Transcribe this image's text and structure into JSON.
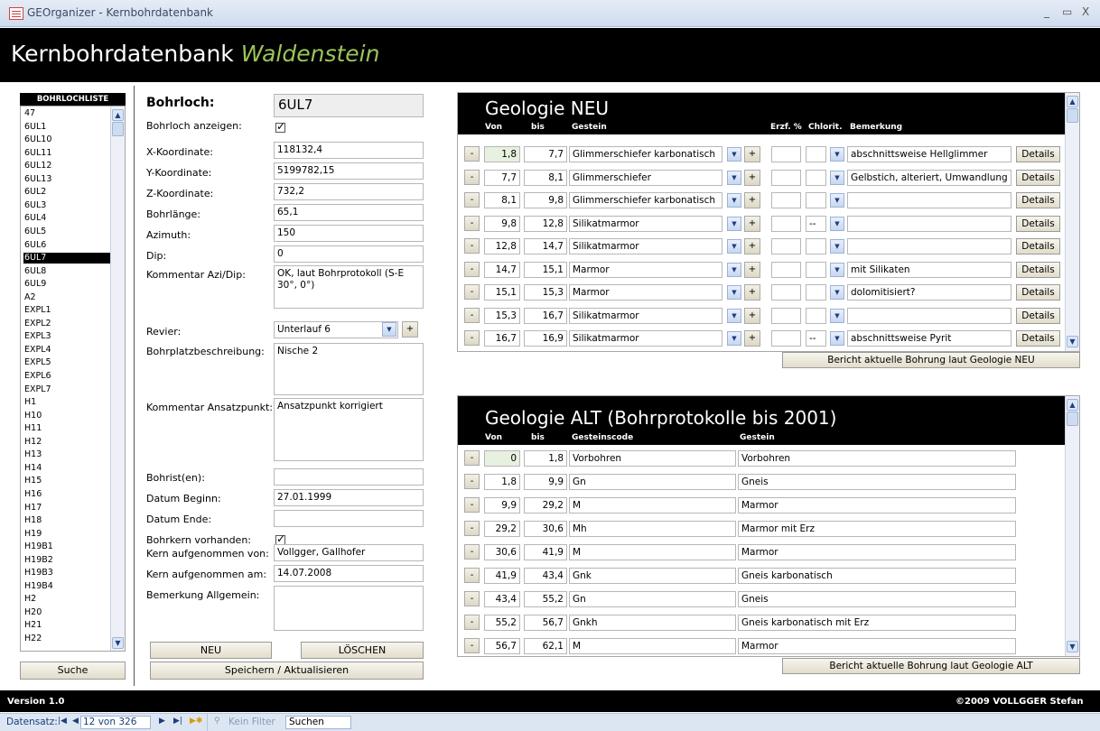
{
  "window": {
    "title": "GEOrganizer - Kernbohrdatenbank"
  },
  "header": {
    "title_main": "Kernbohrdatenbank",
    "title_accent": "Waldenstein"
  },
  "sidebar": {
    "header": "BOHRLOCHLISTE",
    "items": [
      "47",
      "6UL1",
      "6UL10",
      "6UL11",
      "6UL12",
      "6UL13",
      "6UL2",
      "6UL3",
      "6UL4",
      "6UL5",
      "6UL6",
      "6UL7",
      "6UL8",
      "6UL9",
      "A2",
      "EXPL1",
      "EXPL2",
      "EXPL3",
      "EXPL4",
      "EXPL5",
      "EXPL6",
      "EXPL7",
      "H1",
      "H10",
      "H11",
      "H12",
      "H13",
      "H14",
      "H15",
      "H16",
      "H17",
      "H18",
      "H19",
      "H19B1",
      "H19B2",
      "H19B3",
      "H19B4",
      "H2",
      "H20",
      "H21",
      "H22"
    ],
    "selected": "6UL7",
    "search_button": "Suche"
  },
  "form": {
    "bohrloch_label": "Bohrloch:",
    "bohrloch_value": "6UL7",
    "anzeigen_label": "Bohrloch anzeigen:",
    "x_label": "X-Koordinate:",
    "x_value": "118132,4",
    "y_label": "Y-Koordinate:",
    "y_value": "5199782,15",
    "z_label": "Z-Koordinate:",
    "z_value": "732,2",
    "laenge_label": "Bohrlänge:",
    "laenge_value": "65,1",
    "azimuth_label": "Azimuth:",
    "azimuth_value": "150",
    "dip_label": "Dip:",
    "dip_value": "0",
    "kommentar_azi_label": "Kommentar Azi/Dip:",
    "kommentar_azi_value": "OK, laut Bohrprotokoll (S-E 30°, 0°)",
    "revier_label": "Revier:",
    "revier_value": "Unterlauf 6",
    "platz_label": "Bohrplatzbeschreibung:",
    "platz_value": "Nische 2",
    "ansatz_label": "Kommentar Ansatzpunkt:",
    "ansatz_value": "Ansatzpunkt korrigiert",
    "bohrist_label": "Bohrist(en):",
    "bohrist_value": "",
    "beginn_label": "Datum Beginn:",
    "beginn_value": "27.01.1999",
    "ende_label": "Datum Ende:",
    "ende_value": "",
    "kern_label": "Bohrkern vorhanden:",
    "aufg_von_label": "Kern aufgenommen von:",
    "aufg_von_value": "Vollgger, Gallhofer",
    "aufg_am_label": "Kern aufgenommen am:",
    "aufg_am_value": "14.07.2008",
    "bemerkung_label": "Bemerkung Allgemein:",
    "bemerkung_value": "",
    "neu_button": "NEU",
    "loeschen_button": "LÖSCHEN",
    "speichern_button": "Speichern / Aktualisieren"
  },
  "geologie_neu": {
    "title": "Geologie NEU",
    "headers": {
      "von": "Von",
      "bis": "bis",
      "gestein": "Gestein",
      "erzf": "Erzf. %",
      "chlorit": "Chlorit.",
      "bemerkung": "Bemerkung"
    },
    "rows": [
      {
        "von": "1,8",
        "bis": "7,7",
        "gestein": "Glimmerschiefer karbonatisch",
        "chlorit": "",
        "bemerkung": "abschnittsweise Hellglimmer"
      },
      {
        "von": "7,7",
        "bis": "8,1",
        "gestein": "Glimmerschiefer",
        "chlorit": "",
        "bemerkung": "Gelbstich, alteriert, Umwandlung"
      },
      {
        "von": "8,1",
        "bis": "9,8",
        "gestein": "Glimmerschiefer karbonatisch",
        "chlorit": "",
        "bemerkung": ""
      },
      {
        "von": "9,8",
        "bis": "12,8",
        "gestein": "Silikatmarmor",
        "chlorit": "--",
        "bemerkung": ""
      },
      {
        "von": "12,8",
        "bis": "14,7",
        "gestein": "Silikatmarmor",
        "chlorit": "",
        "bemerkung": ""
      },
      {
        "von": "14,7",
        "bis": "15,1",
        "gestein": "Marmor",
        "chlorit": "",
        "bemerkung": "mit Silikaten"
      },
      {
        "von": "15,1",
        "bis": "15,3",
        "gestein": "Marmor",
        "chlorit": "",
        "bemerkung": "dolomitisiert?"
      },
      {
        "von": "15,3",
        "bis": "16,7",
        "gestein": "Silikatmarmor",
        "chlorit": "",
        "bemerkung": ""
      },
      {
        "von": "16,7",
        "bis": "16,9",
        "gestein": "Silikatmarmor",
        "chlorit": "--",
        "bemerkung": "abschnittsweise Pyrit"
      }
    ],
    "details_label": "Details",
    "report_button": "Bericht aktuelle Bohrung laut Geologie NEU"
  },
  "geologie_alt": {
    "title": "Geologie ALT (Bohrprotokolle bis 2001)",
    "headers": {
      "von": "Von",
      "bis": "bis",
      "code": "Gesteinscode",
      "gestein": "Gestein"
    },
    "rows": [
      {
        "von": "0",
        "bis": "1,8",
        "code": "Vorbohren",
        "gestein": "Vorbohren"
      },
      {
        "von": "1,8",
        "bis": "9,9",
        "code": "Gn",
        "gestein": "Gneis"
      },
      {
        "von": "9,9",
        "bis": "29,2",
        "code": "M",
        "gestein": "Marmor"
      },
      {
        "von": "29,2",
        "bis": "30,6",
        "code": "Mh",
        "gestein": "Marmor mit Erz"
      },
      {
        "von": "30,6",
        "bis": "41,9",
        "code": "M",
        "gestein": "Marmor"
      },
      {
        "von": "41,9",
        "bis": "43,4",
        "code": "Gnk",
        "gestein": "Gneis karbonatisch"
      },
      {
        "von": "43,4",
        "bis": "55,2",
        "code": "Gn",
        "gestein": "Gneis"
      },
      {
        "von": "55,2",
        "bis": "56,7",
        "code": "Gnkh",
        "gestein": "Gneis karbonatisch mit Erz"
      },
      {
        "von": "56,7",
        "bis": "62,1",
        "code": "M",
        "gestein": "Marmor"
      }
    ],
    "report_button": "Bericht aktuelle Bohrung laut Geologie ALT"
  },
  "footer": {
    "version": "Version 1.0",
    "copyright": "©2009 VOLLGGER Stefan"
  },
  "statusbar": {
    "label": "Datensatz:",
    "record": "12 von 326",
    "filter": "Kein Filter",
    "search": "Suchen"
  },
  "colors": {
    "accent": "#9bc55a",
    "header_bg": "#000000",
    "selected_row": "#000000"
  }
}
